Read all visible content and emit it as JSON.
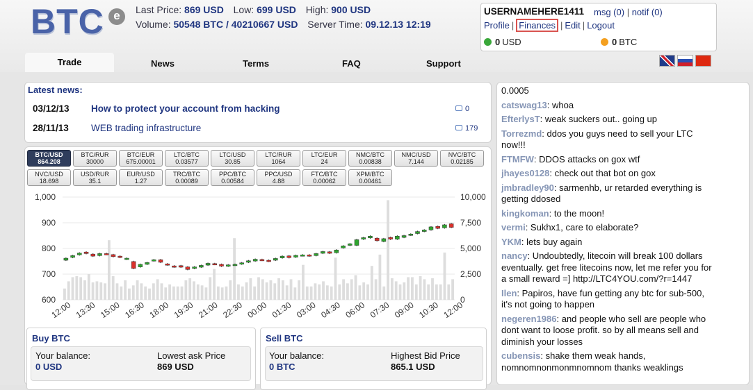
{
  "logo": {
    "text": "BTC",
    "badge": "e"
  },
  "stats": {
    "last_price_label": "Last Price:",
    "last_price": "869 USD",
    "low_label": "Low:",
    "low": "699 USD",
    "high_label": "High:",
    "high": "900 USD",
    "volume_label": "Volume:",
    "volume": "50548 BTC / 40210667 USD",
    "server_time_label": "Server Time:",
    "server_time": "09.12.13 12:19"
  },
  "user": {
    "username": "USERNAMEHERE1411",
    "msg": "msg (0)",
    "notif": "notif (0)",
    "links": [
      "Profile",
      "Finances",
      "Edit",
      "Logout"
    ],
    "usd_amount": "0",
    "usd_label": "USD",
    "btc_amount": "0",
    "btc_label": "BTC"
  },
  "nav": {
    "tabs": [
      "Trade",
      "News",
      "Terms",
      "FAQ",
      "Support"
    ]
  },
  "news": {
    "title": "Latest news:",
    "items": [
      {
        "date": "03/12/13",
        "title": "How to protect your account from hacking",
        "comments": "0"
      },
      {
        "date": "28/11/13",
        "title": "WEB trading infrastructure",
        "comments": "179"
      }
    ]
  },
  "pairs": [
    {
      "name": "BTC/USD",
      "price": "864.208"
    },
    {
      "name": "BTC/RUR",
      "price": "30000"
    },
    {
      "name": "BTC/EUR",
      "price": "675.00001"
    },
    {
      "name": "LTC/BTC",
      "price": "0.03577"
    },
    {
      "name": "LTC/USD",
      "price": "30.85"
    },
    {
      "name": "LTC/RUR",
      "price": "1064"
    },
    {
      "name": "LTC/EUR",
      "price": "24"
    },
    {
      "name": "NMC/BTC",
      "price": "0.00838"
    },
    {
      "name": "NMC/USD",
      "price": "7.144"
    },
    {
      "name": "NVC/BTC",
      "price": "0.02185"
    },
    {
      "name": "NVC/USD",
      "price": "18.698"
    },
    {
      "name": "USD/RUR",
      "price": "35.1"
    },
    {
      "name": "EUR/USD",
      "price": "1.27"
    },
    {
      "name": "TRC/BTC",
      "price": "0.00089"
    },
    {
      "name": "PPC/BTC",
      "price": "0.00584"
    },
    {
      "name": "PPC/USD",
      "price": "4.88"
    },
    {
      "name": "FTC/BTC",
      "price": "0.00062"
    },
    {
      "name": "XPM/BTC",
      "price": "0.00461"
    }
  ],
  "chart_data": {
    "type": "candlestick",
    "x_ticks": [
      "12:00",
      "13:30",
      "15:00",
      "16:30",
      "18:00",
      "19:30",
      "21:00",
      "22:30",
      "00:00",
      "01:30",
      "03:00",
      "04:30",
      "06:00",
      "07:30",
      "09:00",
      "10:30",
      "12:00"
    ],
    "y_left_ticks": [
      "1,000",
      "900",
      "800",
      "700",
      "600"
    ],
    "y_right_ticks": [
      "10,000",
      "7,500",
      "5,000",
      "2,500",
      "0"
    ],
    "ylim": [
      600,
      1000
    ],
    "y2lim": [
      0,
      10000
    ],
    "candles": [
      [
        754,
        762
      ],
      [
        765,
        772
      ],
      [
        775,
        782
      ],
      [
        786,
        780
      ],
      [
        778,
        770
      ],
      [
        772,
        780
      ],
      [
        780,
        777
      ],
      [
        776,
        768
      ],
      [
        770,
        765
      ],
      [
        758,
        762
      ],
      [
        749,
        722
      ],
      [
        728,
        738
      ],
      [
        738,
        745
      ],
      [
        752,
        756
      ],
      [
        756,
        746
      ],
      [
        740,
        736
      ],
      [
        732,
        728
      ],
      [
        733,
        727
      ],
      [
        728,
        718
      ],
      [
        722,
        728
      ],
      [
        727,
        734
      ],
      [
        735,
        742
      ],
      [
        741,
        738
      ],
      [
        738,
        731
      ],
      [
        731,
        736
      ],
      [
        736,
        738
      ],
      [
        739,
        744
      ],
      [
        746,
        752
      ],
      [
        751,
        758
      ],
      [
        757,
        754
      ],
      [
        754,
        750
      ],
      [
        754,
        761
      ],
      [
        763,
        770
      ],
      [
        771,
        764
      ],
      [
        766,
        773
      ],
      [
        772,
        775
      ],
      [
        775,
        771
      ],
      [
        772,
        780
      ],
      [
        781,
        788
      ],
      [
        787,
        781
      ],
      [
        783,
        794
      ],
      [
        802,
        810
      ],
      [
        812,
        818
      ],
      [
        812,
        834
      ],
      [
        836,
        842
      ],
      [
        841,
        848
      ],
      [
        840,
        830
      ],
      [
        827,
        838
      ],
      [
        843,
        836
      ],
      [
        836,
        848
      ],
      [
        843,
        850
      ],
      [
        852,
        856
      ],
      [
        858,
        866
      ],
      [
        866,
        872
      ],
      [
        872,
        884
      ],
      [
        886,
        878
      ],
      [
        880,
        892
      ],
      [
        896,
        882
      ]
    ],
    "volume": [
      1100,
      1800,
      2200,
      2300,
      2200,
      1900,
      2500,
      1700,
      1800,
      1700,
      1600,
      5800,
      2300,
      1600,
      1300,
      1900,
      1100,
      1400,
      1900,
      1600,
      1300,
      1100,
      1600,
      2000,
      1600,
      1200,
      1500,
      1300,
      1300,
      1300,
      1900,
      2100,
      1800,
      1500,
      1400,
      1200,
      2200,
      3000,
      1300,
      1200,
      1300,
      1900,
      6000,
      1500,
      1300,
      1700,
      2100,
      1300,
      2200,
      2000,
      1700,
      1900,
      1600,
      2100,
      1900,
      1400,
      2000,
      1200,
      1900,
      3400,
      1300,
      1300,
      1600,
      1500,
      1800,
      1400,
      1300,
      4100,
      1500,
      2000,
      1600,
      2000,
      2400,
      1400,
      1700,
      1500,
      3300,
      2000,
      4400,
      1300,
      9700,
      2100,
      1800,
      1500,
      1700,
      2200,
      2200,
      1500,
      2300,
      2000,
      1500,
      2100,
      1500,
      1500,
      4600,
      1500,
      2000
    ]
  },
  "buy": {
    "title": "Buy BTC",
    "balance_label": "Your balance:",
    "balance": "0 USD",
    "price_label": "Lowest ask Price",
    "price": "869 USD"
  },
  "sell": {
    "title": "Sell BTC",
    "balance_label": "Your balance:",
    "balance": "0 BTC",
    "price_label": "Highest Bid Price",
    "price": "865.1 USD"
  },
  "chat": [
    {
      "user": "",
      "text": "0.0005"
    },
    {
      "user": "catswag13",
      "text": ": whoa"
    },
    {
      "user": "EfterlysT",
      "text": ": weak suckers out.. going up"
    },
    {
      "user": "Torrezmd",
      "text": ": ddos you guys need to sell your LTC now!!!"
    },
    {
      "user": "FTMFW",
      "text": ": DDOS attacks on gox wtf"
    },
    {
      "user": "jhayes0128",
      "text": ": check out that bot on gox"
    },
    {
      "user": "jmbradley90",
      "text": ": sarmenhb, ur retarded everything is getting ddosed"
    },
    {
      "user": "kingkoman",
      "text": ": to the moon!"
    },
    {
      "user": "vermi",
      "text": ": Sukhx1, care to elaborate?"
    },
    {
      "user": "YKM",
      "text": ": lets buy again"
    },
    {
      "user": "nancy",
      "text": ": Undoubtedly, litecoin will break 100 dollars eventually. get free litecoins now, let me refer you for a small reward =] http://LTC4YOU.com/?r=1447"
    },
    {
      "user": "Ilen",
      "text": ": Papiros, have fun getting any btc for sub-500, it's not going to happen"
    },
    {
      "user": "negeren1986",
      "text": ": and people who sell are people who dont want to loose profit. so by all means sell and diminish your losses"
    },
    {
      "user": "cubensis",
      "text": ": shake them weak hands, nomnomnonmonmnomnom thanks weaklings"
    }
  ],
  "colors": {
    "brand": "#4a63a8",
    "link": "#1f3580",
    "up": "#2ea52e",
    "down": "#d9302b",
    "volume": "#dddddd"
  }
}
